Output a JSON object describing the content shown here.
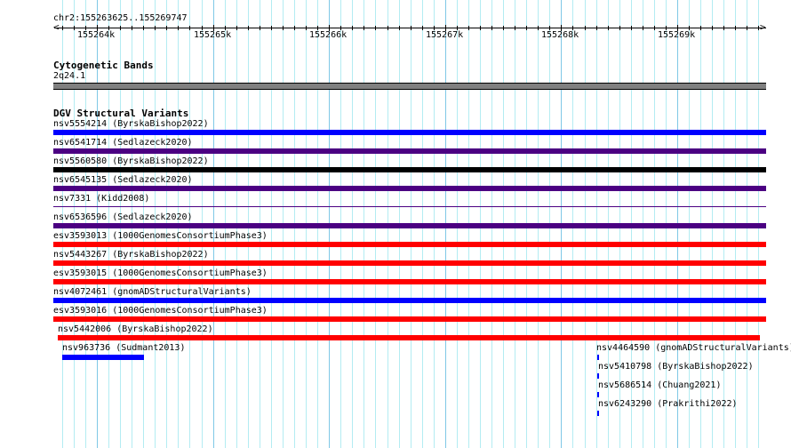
{
  "ruler": {
    "position": "chr2:155263625..155269747",
    "ticks": [
      "155264k",
      "155265k",
      "155266k",
      "155267k",
      "155268k",
      "155269k"
    ]
  },
  "cyto": {
    "title": "Cytogenetic Bands",
    "band": "2q24.1",
    "color": "#808080"
  },
  "dgv": {
    "title": "DGV Structural Variants",
    "features": [
      {
        "label": "nsv5554214 (ByrskaBishop2022)",
        "color": "#0000ff"
      },
      {
        "label": "nsv6541714 (Sedlazeck2020)",
        "color": "#4b0082"
      },
      {
        "label": "nsv5560580 (ByrskaBishop2022)",
        "color": "#000000"
      },
      {
        "label": "nsv6545135 (Sedlazeck2020)",
        "color": "#4b0082"
      },
      {
        "label": "nsv7331 (Kidd2008)",
        "color": "#4b0082"
      },
      {
        "label": "nsv6536596 (Sedlazeck2020)",
        "color": "#4b0082"
      },
      {
        "label": "esv3593013 (1000GenomesConsortiumPhase3)",
        "color": "#ff0000"
      },
      {
        "label": "nsv5443267 (ByrskaBishop2022)",
        "color": "#ff0000"
      },
      {
        "label": "esv3593015 (1000GenomesConsortiumPhase3)",
        "color": "#ff0000"
      },
      {
        "label": "nsv4072461 (gnomADStructuralVariants)",
        "color": "#0000ff"
      },
      {
        "label": "esv3593016 (1000GenomesConsortiumPhase3)",
        "color": "#ff0000"
      },
      {
        "label": "nsv5442006 (ByrskaBishop2022)",
        "color": "#ff0000"
      },
      {
        "label": "nsv963736 (Sudmant2013)",
        "color": "#0000ff"
      },
      {
        "label": "nsv4464590 (gnomADStructuralVariants)",
        "color": "#0000ff"
      },
      {
        "label": "nsv5410798 (ByrskaBishop2022)",
        "color": "#0000ff"
      },
      {
        "label": "nsv5686514 (Chuang2021)",
        "color": "#0000ff"
      },
      {
        "label": "nsv6243290 (Prakrithi2022)",
        "color": "#0000ff"
      }
    ]
  }
}
